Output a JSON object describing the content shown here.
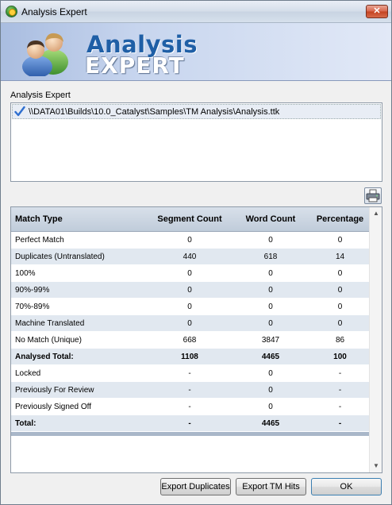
{
  "window": {
    "title": "Analysis Expert",
    "close_label": "✕"
  },
  "banner": {
    "title_line1": "Analysis",
    "title_line2": "EXPERT"
  },
  "section": {
    "label": "Analysis Expert"
  },
  "files": [
    {
      "checked": true,
      "path": "\\\\DATA01\\Builds\\10.0_Catalyst\\Samples\\TM Analysis\\Analysis.ttk"
    }
  ],
  "table": {
    "columns": [
      "Match Type",
      "Segment Count",
      "Word Count",
      "Percentage"
    ],
    "rows": [
      {
        "type": "Perfect Match",
        "segments": "0",
        "words": "0",
        "percent": "0"
      },
      {
        "type": "Duplicates (Untranslated)",
        "segments": "440",
        "words": "618",
        "percent": "14"
      },
      {
        "type": "100%",
        "segments": "0",
        "words": "0",
        "percent": "0"
      },
      {
        "type": "90%-99%",
        "segments": "0",
        "words": "0",
        "percent": "0"
      },
      {
        "type": "70%-89%",
        "segments": "0",
        "words": "0",
        "percent": "0"
      },
      {
        "type": "Machine Translated",
        "segments": "0",
        "words": "0",
        "percent": "0"
      },
      {
        "type": "No Match (Unique)",
        "segments": "668",
        "words": "3847",
        "percent": "86"
      },
      {
        "type": "Analysed Total:",
        "segments": "1108",
        "words": "4465",
        "percent": "100"
      },
      {
        "type": "Locked",
        "segments": "-",
        "words": "0",
        "percent": "-"
      },
      {
        "type": "Previously For Review",
        "segments": "-",
        "words": "0",
        "percent": "-"
      },
      {
        "type": "Previously Signed Off",
        "segments": "-",
        "words": "0",
        "percent": "-"
      },
      {
        "type": "Total:",
        "segments": "-",
        "words": "4465",
        "percent": "-"
      }
    ]
  },
  "buttons": {
    "export_duplicates": "Export Duplicates",
    "export_tm_hits": "Export TM Hits",
    "ok": "OK"
  },
  "icons": {
    "app": "app-globe-icon",
    "logo": "users-logo-icon",
    "check": "checkmark-icon",
    "print": "printer-icon",
    "close": "close-icon"
  },
  "colors": {
    "header_gradient_top": "#d8e0ea",
    "row_alt": "#e1e8f0",
    "banner_title": "#1f5fa6",
    "close_button": "#c4411f"
  }
}
